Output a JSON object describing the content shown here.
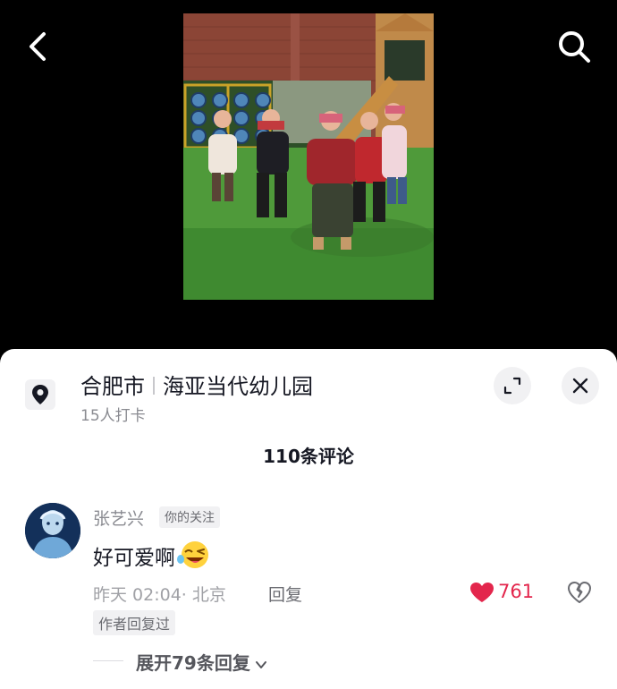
{
  "header": {
    "back_icon": "chevron-left-icon",
    "search_icon": "search-icon"
  },
  "location": {
    "city": "合肥市",
    "place": "海亚当代幼儿园",
    "checkins": "15人打卡",
    "icon": "location-pin-icon"
  },
  "comments": {
    "count_label": "110条评论",
    "items": [
      {
        "username": "张艺兴",
        "badge": "你的关注",
        "text": "好可爱啊",
        "emoji": "laughing-wink-emoji",
        "time": "昨天 02:04",
        "location": "· 北京",
        "reply_label": "回复",
        "likes": "761",
        "like_color": "#e3264c",
        "author_badge": "作者回复过",
        "expand_label": "展开79条回复"
      }
    ]
  }
}
